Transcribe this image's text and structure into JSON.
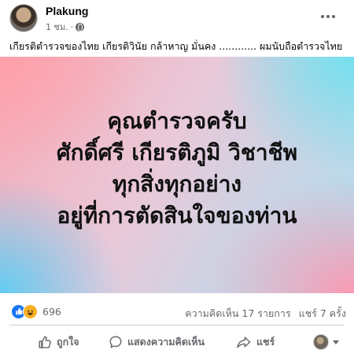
{
  "post": {
    "author": "Plakung",
    "time": "1 ชม.",
    "dot": "·",
    "caption": "เกียรติตำรวจของไทย เกียรติวินัย กล้าหาญ มั่นคง ............ ผมนับถือตำรวจไทย",
    "image_text": {
      "line1": "คุณตำรวจครับ",
      "line2": "ศักดิ์ศรี เกียรติภูมิ วิชาชีพ",
      "line3": "ทุกสิ่งทุกอย่าง",
      "line4": "อยู่ที่การตัดสินใจของท่าน"
    },
    "reactions": {
      "count": "696",
      "like_glyph": "👍",
      "haha_glyph": "😆"
    },
    "stats": {
      "comments": "ความคิดเห็น 17 รายการ",
      "shares": "แชร์ 7 ครั้ง"
    },
    "actions": {
      "like": "ถูกใจ",
      "comment": "แสดงความคิดเห็น",
      "share": "แชร์"
    },
    "icons": {
      "privacy": "globe-icon",
      "more": "more-options-icon",
      "like": "thumbs-up-icon",
      "comment": "comment-icon",
      "share": "share-icon"
    },
    "colors": {
      "like_blue": "#1877f2",
      "haha_yellow": "#f7b125",
      "secondary_text": "#65676b"
    }
  }
}
